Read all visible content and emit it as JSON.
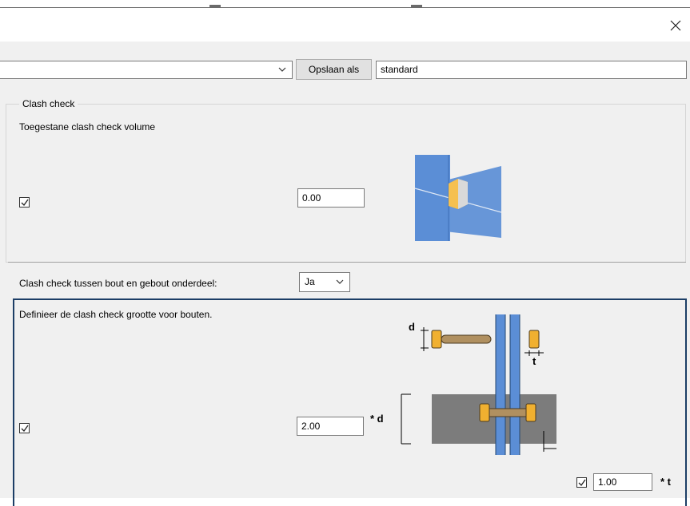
{
  "window": {
    "close_icon": "close-icon"
  },
  "toolbar": {
    "preset_value": "",
    "save_as_label": "Opslaan als",
    "save_name_value": "standard"
  },
  "clash_check": {
    "group_title": "Clash check",
    "allowed_volume_label": "Toegestane clash check volume",
    "allowed_volume_checked": true,
    "allowed_volume_value": "0.00"
  },
  "bolt_clash": {
    "label": "Clash check tussen bout en gebout onderdeel:",
    "selected": "Ja"
  },
  "bolt_size": {
    "description": "Definieer de clash check grootte voor bouten.",
    "diameter_checked": true,
    "diameter_factor": "2.00",
    "diameter_unit": "* d",
    "thickness_checked": true,
    "thickness_factor": "1.00",
    "thickness_unit": "* t",
    "dim_d": "d",
    "dim_t": "t"
  },
  "colors": {
    "plate_blue": "#5b8ed6",
    "bolt_orange": "#f0b030",
    "grey_zone": "#7c7c7c",
    "focus_border": "#1c3e66"
  }
}
